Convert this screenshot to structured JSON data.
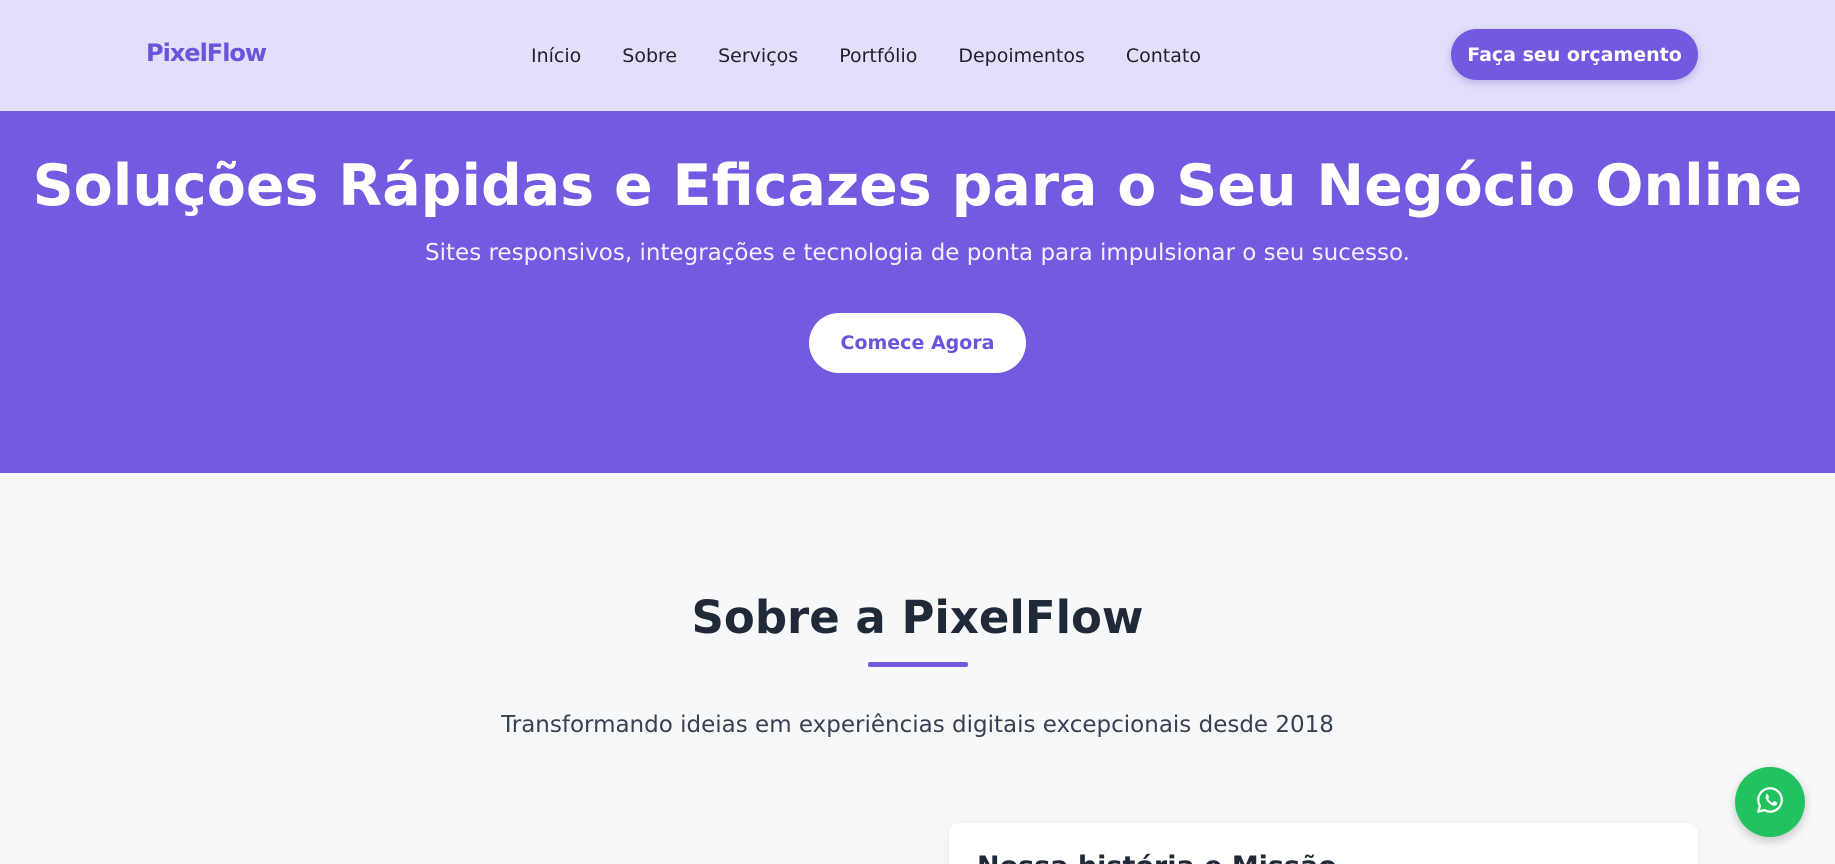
{
  "header": {
    "logo_text": "PixelFlow",
    "nav": [
      "Início",
      "Sobre",
      "Serviços",
      "Portfólio",
      "Depoimentos",
      "Contato"
    ],
    "cta_label": "Faça seu orçamento"
  },
  "hero": {
    "title": "Soluções Rápidas e Eficazes para o Seu Negócio Online",
    "subtitle": "Sites responsivos, integrações e tecnologia de ponta para impulsionar o seu sucesso.",
    "button_label": "Comece Agora"
  },
  "about": {
    "title": "Sobre a PixelFlow",
    "subtitle": "Transformando ideias em experiências digitais excepcionais desde 2018",
    "card_title": "Nossa história e Missão"
  },
  "floating": {
    "whatsapp_icon": "whatsapp-icon"
  },
  "colors": {
    "brand": "#745ae0",
    "header_bg": "#e1dffa",
    "whatsapp": "#22c25e"
  }
}
